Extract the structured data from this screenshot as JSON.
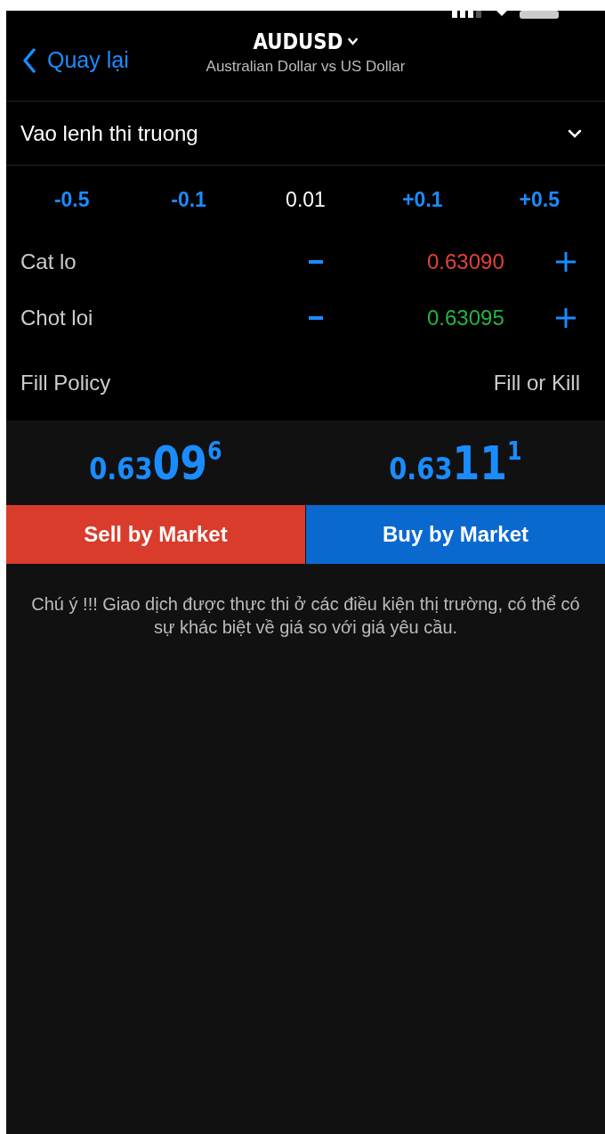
{
  "nav": {
    "back_label": "Quay lại",
    "symbol": "AUDUSD",
    "description": "Australian Dollar vs US Dollar"
  },
  "order_type": {
    "label": "Vao lenh thi truong"
  },
  "volume_steps": [
    {
      "kind": "adjust",
      "label": "-0.5"
    },
    {
      "kind": "adjust",
      "label": "-0.1"
    },
    {
      "kind": "value",
      "label": "0.01"
    },
    {
      "kind": "adjust",
      "label": "+0.1"
    },
    {
      "kind": "adjust",
      "label": "+0.5"
    }
  ],
  "levels": [
    {
      "label": "Cat lo",
      "value": "0.63090",
      "color": "#e0433a"
    },
    {
      "label": "Chot loi",
      "value": "0.63095",
      "color": "#25b33f"
    }
  ],
  "fill_policy": {
    "label": "Fill Policy",
    "value": "Fill or Kill"
  },
  "prices": [
    {
      "prefix": "0.63",
      "big": "09",
      "pip": "6"
    },
    {
      "prefix": "0.63",
      "big": "11",
      "pip": "1"
    }
  ],
  "actions": [
    {
      "kind": "sell",
      "label": "Sell by Market"
    },
    {
      "kind": "buy",
      "label": "Buy by Market"
    }
  ],
  "note": "Chú ý !!! Giao dịch được thực thi ở các điều kiện thị trường, có thể có sự khác biệt về giá so với giá yêu cầu."
}
